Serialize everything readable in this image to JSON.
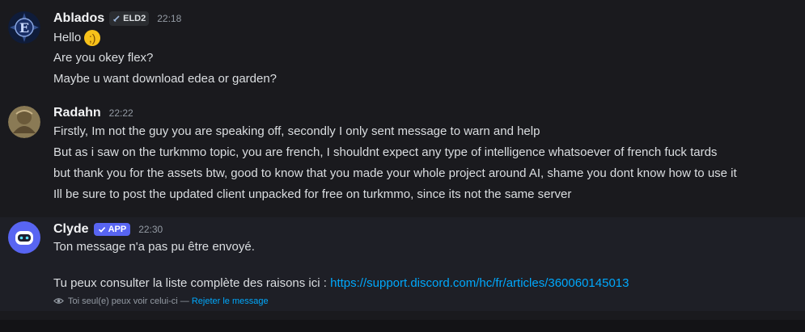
{
  "messages": [
    {
      "username": "Ablados",
      "clan_tag": "ELD2",
      "timestamp": "22:18",
      "lines": [
        "Hello",
        "Are you okey flex?",
        "Maybe u want download edea or garden?"
      ],
      "emoji": "wink-face"
    },
    {
      "username": "Radahn",
      "timestamp": "22:22",
      "lines": [
        "Firstly, Im not the guy you  are speaking off, secondly I only sent message to warn and help",
        "But as i saw on the turkmmo topic, you are french, I shouldnt  expect any type of intelligence whatsoever of french fuck tards",
        "but thank you for the assets btw, good to know that you made your whole project around AI, shame you dont know how to use it",
        "Ill be sure to post the updated client unpacked for free on turkmmo, since its not the same server"
      ]
    },
    {
      "username": "Clyde",
      "app_tag": "APP",
      "timestamp": "22:30",
      "line1": "Ton message n'a pas pu être envoyé.",
      "line2_prefix": "Tu peux consulter la liste complète des raisons ici : ",
      "line2_link": "https://support.discord.com/hc/fr/articles/360060145013",
      "ephemeral_note": "Toi seul(e) peux voir celui-ci — ",
      "ephemeral_action": "Rejeter le message"
    }
  ],
  "colors": {
    "background": "#1a1a1e",
    "clyde_row": "#1e1f26",
    "link": "#00a8fc",
    "app_tag": "#5865f2"
  }
}
